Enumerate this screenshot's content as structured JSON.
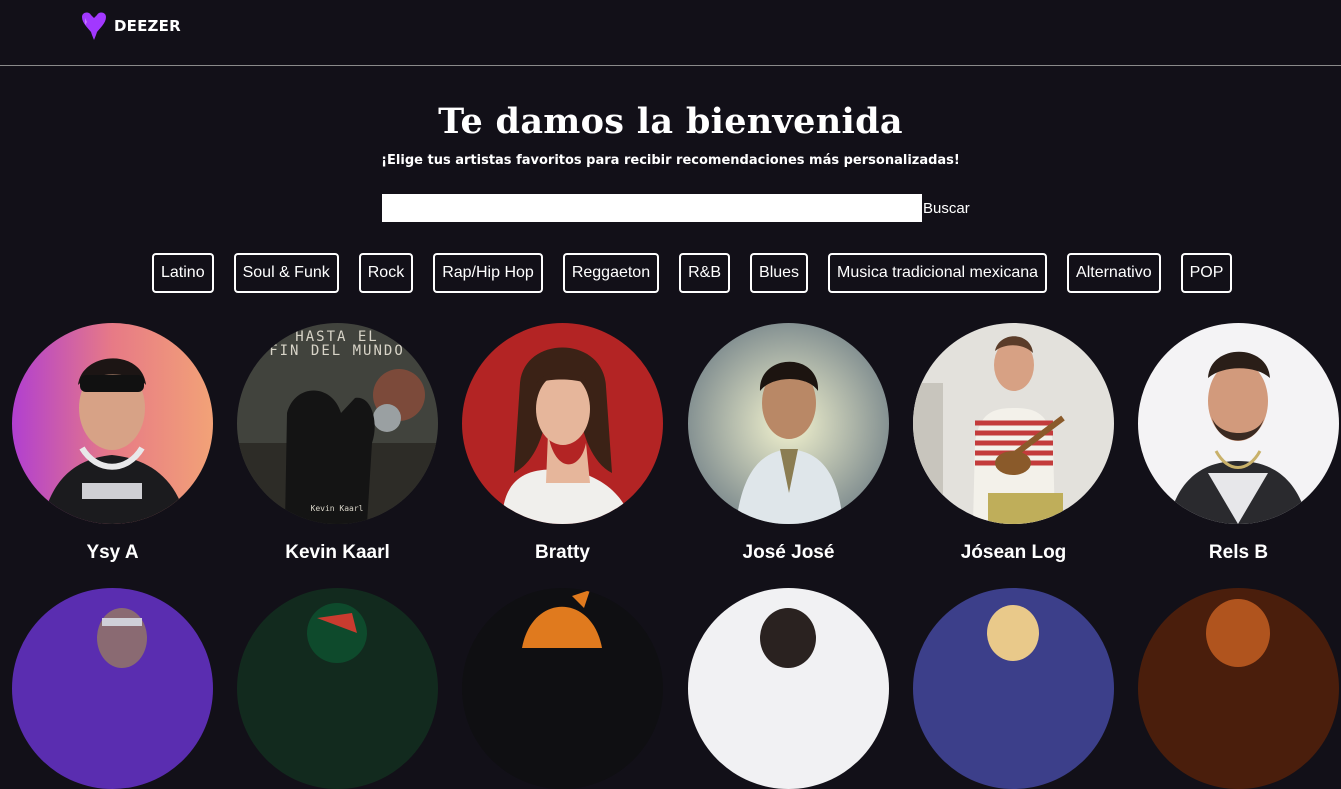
{
  "header": {
    "brand": "DEEZER",
    "brand_color": "#a238ff",
    "logo_icon": "heart-logo-icon"
  },
  "welcome": {
    "title": "Te damos la bienvenida",
    "subtitle": "¡Elige tus artistas favoritos para recibir recomendaciones más personalizadas!"
  },
  "search": {
    "value": "",
    "placeholder": "",
    "button_label": "Buscar"
  },
  "genres": [
    "Latino",
    "Soul & Funk",
    "Rock",
    "Rap/Hip Hop",
    "Reggaeton",
    "R&B",
    "Blues",
    "Musica tradicional mexicana",
    "Alternativo",
    "POP"
  ],
  "artists_row1": [
    {
      "name": "Ysy A",
      "art_caption": ""
    },
    {
      "name": "Kevin Kaarl",
      "art_caption": "HASTA EL FIN DEL MUNDO",
      "art_signature": "Kevin Kaarl"
    },
    {
      "name": "Bratty",
      "art_caption": ""
    },
    {
      "name": "José José",
      "art_caption": ""
    },
    {
      "name": "Jósean Log",
      "art_caption": ""
    },
    {
      "name": "Rels B",
      "art_caption": ""
    }
  ]
}
